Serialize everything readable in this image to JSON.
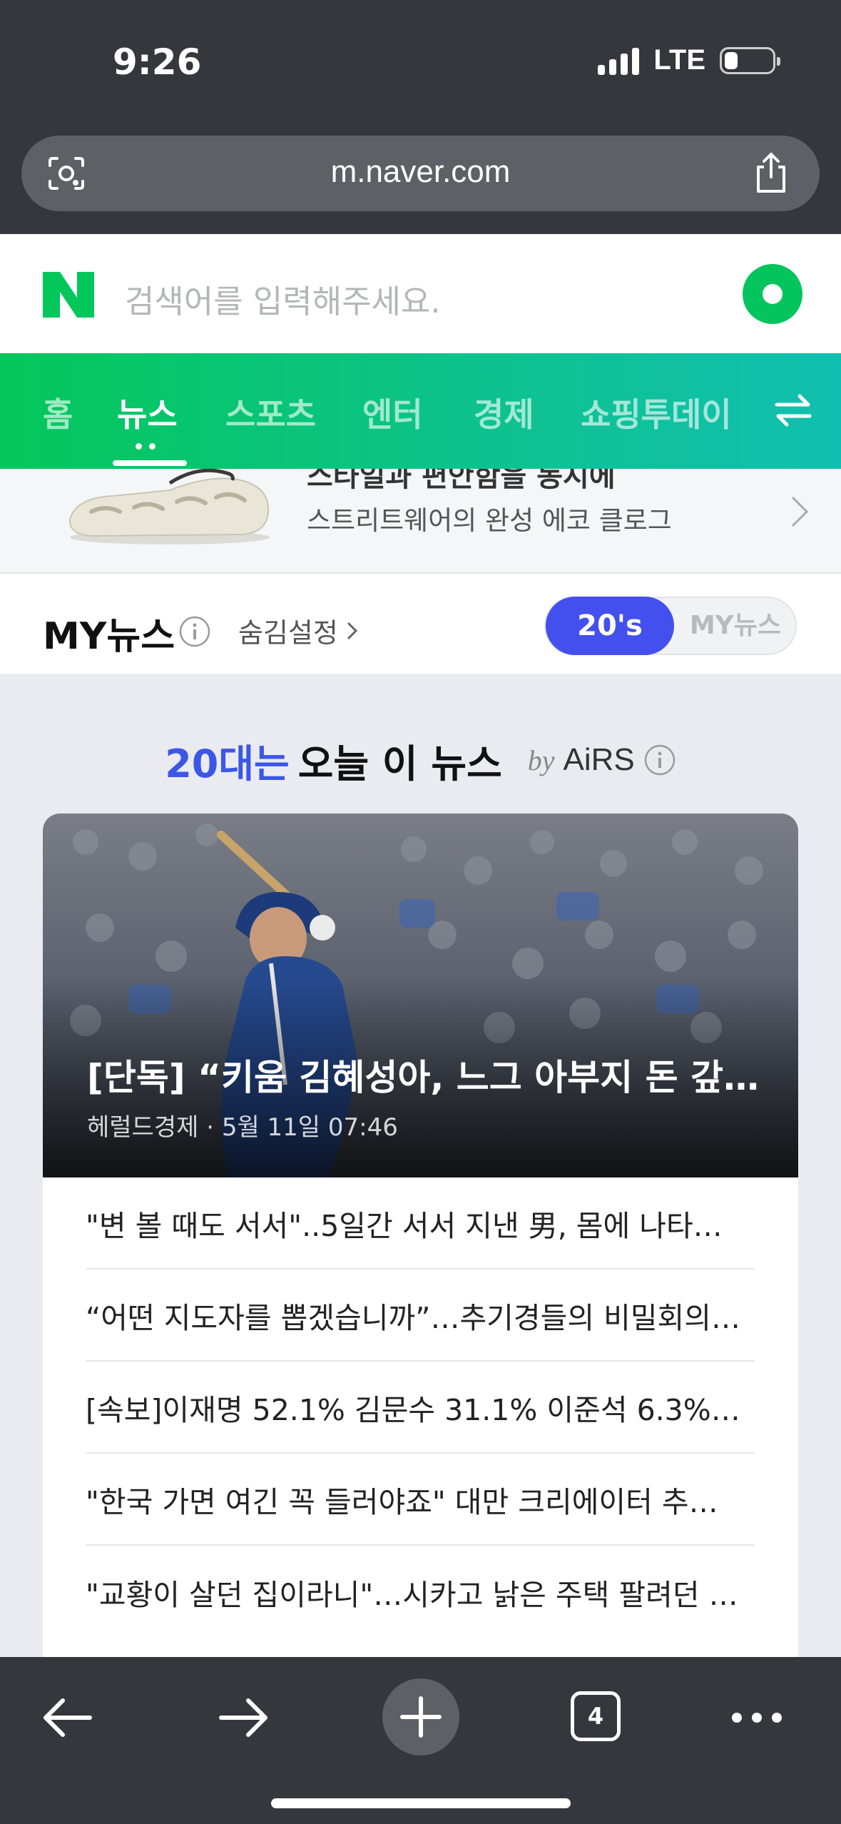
{
  "status_bar": {
    "time": "9:26",
    "network": "LTE"
  },
  "browser": {
    "url": "m.naver.com",
    "tab_count": "4"
  },
  "search": {
    "logo_letter": "N",
    "placeholder": "검색어를 입력해주세요."
  },
  "tabs": [
    {
      "label": "홈"
    },
    {
      "label": "뉴스"
    },
    {
      "label": "스포츠"
    },
    {
      "label": "엔터"
    },
    {
      "label": "경제"
    },
    {
      "label": "쇼핑투데이"
    }
  ],
  "ad": {
    "title": "스타일과 편안함을 동시에",
    "subtitle": "스트리트웨어의 완성 에코 클로그"
  },
  "mynews": {
    "title": "MY뉴스",
    "hide_setting": "숨김설정",
    "toggle_on": "20's",
    "toggle_off": "MY뉴스"
  },
  "section": {
    "heading_highlight": "20대는",
    "heading_rest": "오늘 이 뉴스",
    "by": "by",
    "brand": "AiRS"
  },
  "hero_article": {
    "title": "[단독] “키움 김혜성아, 느그 아부지 돈 갚으…",
    "meta": "헤럴드경제 · 5월 11일 07:46"
  },
  "articles": [
    {
      "title": "\"변 볼 때도 서서\"..5일간 서서 지낸 男, 몸에 나타…"
    },
    {
      "title": "“어떤 지도자를 뽑겠습니까”…추기경들의 비밀회의…"
    },
    {
      "title": "[속보]이재명 52.1% 김문수 31.1% 이준석 6.3%…"
    },
    {
      "title": "\"한국 가면 여긴 꼭 들러야죠\" 대만 크리에이터 추…"
    },
    {
      "title": "\"교황이 살던 집이라니\"…시카고 낡은 주택 팔려던 …"
    }
  ],
  "colors": {
    "naver_green": "#03c75a",
    "accent_blue": "#3c57e6",
    "chrome_dark": "#34373b"
  }
}
